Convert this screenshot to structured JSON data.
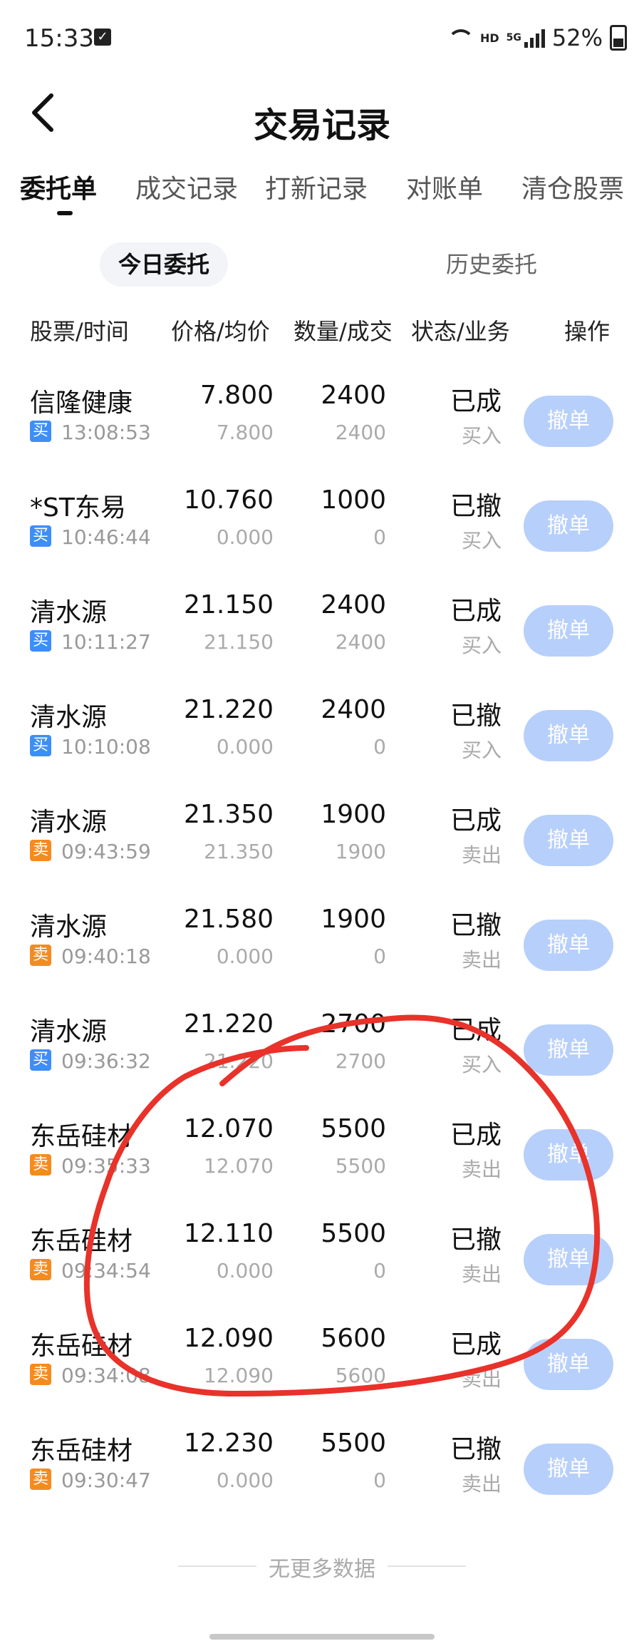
{
  "status_bar": {
    "time": "15:33",
    "hd": "HD",
    "network": "5G",
    "battery": "52%"
  },
  "header": {
    "title": "交易记录"
  },
  "tabs": [
    {
      "label": "委托单",
      "active": true
    },
    {
      "label": "成交记录",
      "active": false
    },
    {
      "label": "打新记录",
      "active": false
    },
    {
      "label": "对账单",
      "active": false
    },
    {
      "label": "清仓股票",
      "active": false
    }
  ],
  "subtabs": {
    "today": "今日委托",
    "history": "历史委托"
  },
  "columns": {
    "stock_time": "股票/时间",
    "price_avg": "价格/均价",
    "qty_filled": "数量/成交",
    "status_biz": "状态/业务",
    "action": "操作"
  },
  "cancel_label": "撤单",
  "orders": [
    {
      "name": "信隆健康",
      "side_badge": "买",
      "time": "13:08:53",
      "price": "7.800",
      "avg": "7.800",
      "qty": "2400",
      "filled": "2400",
      "status": "已成",
      "biz": "买入"
    },
    {
      "name": "*ST东易",
      "side_badge": "买",
      "time": "10:46:44",
      "price": "10.760",
      "avg": "0.000",
      "qty": "1000",
      "filled": "0",
      "status": "已撤",
      "biz": "买入"
    },
    {
      "name": "清水源",
      "side_badge": "买",
      "time": "10:11:27",
      "price": "21.150",
      "avg": "21.150",
      "qty": "2400",
      "filled": "2400",
      "status": "已成",
      "biz": "买入"
    },
    {
      "name": "清水源",
      "side_badge": "买",
      "time": "10:10:08",
      "price": "21.220",
      "avg": "0.000",
      "qty": "2400",
      "filled": "0",
      "status": "已撤",
      "biz": "买入"
    },
    {
      "name": "清水源",
      "side_badge": "卖",
      "time": "09:43:59",
      "price": "21.350",
      "avg": "21.350",
      "qty": "1900",
      "filled": "1900",
      "status": "已成",
      "biz": "卖出"
    },
    {
      "name": "清水源",
      "side_badge": "卖",
      "time": "09:40:18",
      "price": "21.580",
      "avg": "0.000",
      "qty": "1900",
      "filled": "0",
      "status": "已撤",
      "biz": "卖出"
    },
    {
      "name": "清水源",
      "side_badge": "买",
      "time": "09:36:32",
      "price": "21.220",
      "avg": "21.220",
      "qty": "2700",
      "filled": "2700",
      "status": "已成",
      "biz": "买入"
    },
    {
      "name": "东岳硅材",
      "side_badge": "卖",
      "time": "09:35:33",
      "price": "12.070",
      "avg": "12.070",
      "qty": "5500",
      "filled": "5500",
      "status": "已成",
      "biz": "卖出"
    },
    {
      "name": "东岳硅材",
      "side_badge": "卖",
      "time": "09:34:54",
      "price": "12.110",
      "avg": "0.000",
      "qty": "5500",
      "filled": "0",
      "status": "已撤",
      "biz": "卖出"
    },
    {
      "name": "东岳硅材",
      "side_badge": "卖",
      "time": "09:34:08",
      "price": "12.090",
      "avg": "12.090",
      "qty": "5600",
      "filled": "5600",
      "status": "已成",
      "biz": "卖出"
    },
    {
      "name": "东岳硅材",
      "side_badge": "卖",
      "time": "09:30:47",
      "price": "12.230",
      "avg": "0.000",
      "qty": "5500",
      "filled": "0",
      "status": "已撤",
      "biz": "卖出"
    }
  ],
  "footer": {
    "no_more": "无更多数据"
  },
  "colors": {
    "buy_badge": "#3d8ef7",
    "sell_badge": "#f58b1f",
    "cancel_button": "#b7cffb",
    "annotation_stroke": "#e8322a"
  }
}
